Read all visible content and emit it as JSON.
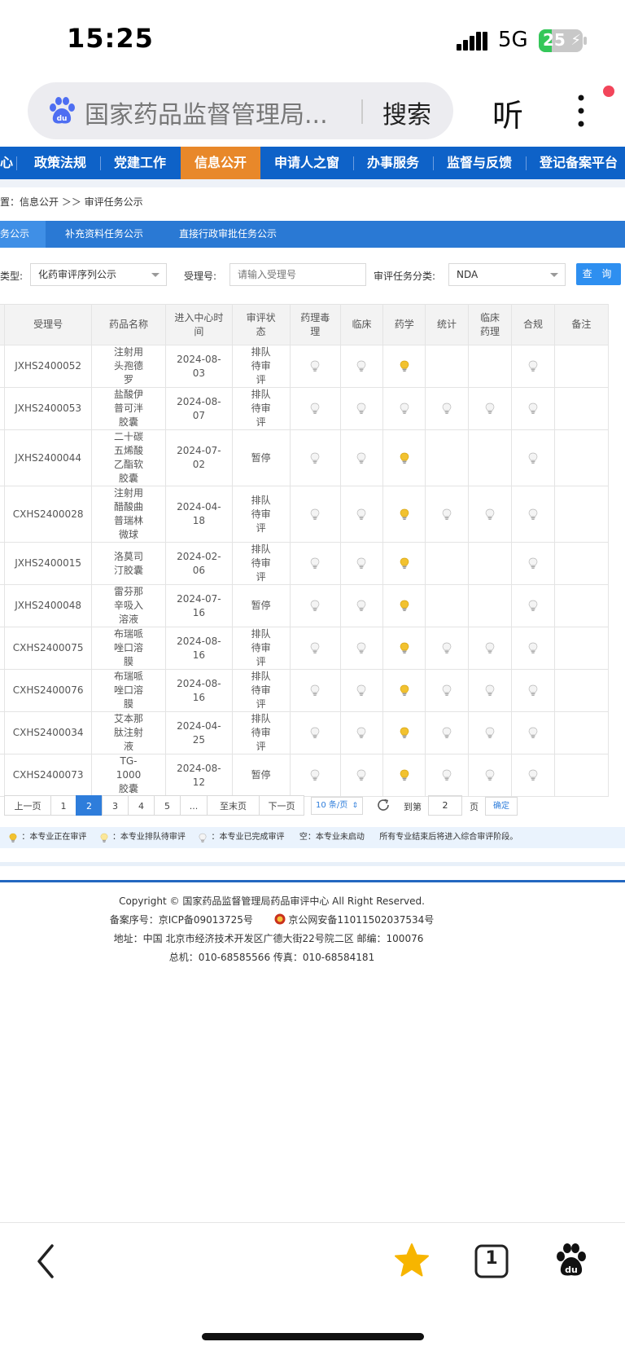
{
  "status": {
    "time": "15:25",
    "network": "5G",
    "battery": "25"
  },
  "browser": {
    "query": "国家药品监督管理局...",
    "search": "搜索",
    "listen": "听"
  },
  "nav": [
    "心",
    "政策法规",
    "党建工作",
    "信息公开",
    "申请人之窗",
    "办事服务",
    "监督与反馈",
    "登记备案平台"
  ],
  "breadcrumb": "置：信息公开 ＞＞ 审评任务公示",
  "tabs": [
    "务公示",
    "补充资料任务公示",
    "直接行政审批任务公示"
  ],
  "filters": {
    "type_label": "类型:",
    "type_value": "化药审评序列公示",
    "accept_label": "受理号:",
    "accept_placeholder": "请输入受理号",
    "category_label": "审评任务分类:",
    "category_value": "NDA",
    "query": "查 询"
  },
  "table": {
    "headers": [
      "受理号",
      "药品名称",
      "进入中心时间",
      "审评状态",
      "药理毒理",
      "临床",
      "药学",
      "统计",
      "临床药理",
      "合规",
      "备注"
    ],
    "rows": [
      {
        "id": "JXHS2400052",
        "name": "注射用头孢德罗",
        "date": "2024-08-03",
        "status": "排队待审评",
        "lights": [
          "w",
          "w",
          "y",
          "",
          "",
          "w",
          ""
        ]
      },
      {
        "id": "JXHS2400053",
        "name": "盐酸伊普可泮胶囊",
        "date": "2024-08-07",
        "status": "排队待审评",
        "lights": [
          "w",
          "w",
          "w",
          "w",
          "w",
          "w",
          ""
        ]
      },
      {
        "id": "JXHS2400044",
        "name": "二十碳五烯酸乙酯软胶囊",
        "date": "2024-07-02",
        "status": "暂停",
        "lights": [
          "w",
          "w",
          "y",
          "",
          "",
          "w",
          ""
        ]
      },
      {
        "id": "CXHS2400028",
        "name": "注射用醋酸曲普瑞林微球",
        "date": "2024-04-18",
        "status": "排队待审评",
        "lights": [
          "w",
          "w",
          "y",
          "w",
          "w",
          "w",
          ""
        ]
      },
      {
        "id": "JXHS2400015",
        "name": "洛莫司汀胶囊",
        "date": "2024-02-06",
        "status": "排队待审评",
        "lights": [
          "w",
          "w",
          "y",
          "",
          "",
          "w",
          ""
        ]
      },
      {
        "id": "JXHS2400048",
        "name": "雷芬那辛吸入溶液",
        "date": "2024-07-16",
        "status": "暂停",
        "lights": [
          "w",
          "w",
          "y",
          "",
          "",
          "w",
          ""
        ]
      },
      {
        "id": "CXHS2400075",
        "name": "布瑞哌唑口溶膜",
        "date": "2024-08-16",
        "status": "排队待审评",
        "lights": [
          "w",
          "w",
          "y",
          "w",
          "w",
          "w",
          ""
        ]
      },
      {
        "id": "CXHS2400076",
        "name": "布瑞哌唑口溶膜",
        "date": "2024-08-16",
        "status": "排队待审评",
        "lights": [
          "w",
          "w",
          "y",
          "w",
          "w",
          "w",
          ""
        ]
      },
      {
        "id": "CXHS2400034",
        "name": "艾本那肽注射液",
        "date": "2024-04-25",
        "status": "排队待审评",
        "lights": [
          "w",
          "w",
          "y",
          "w",
          "w",
          "w",
          ""
        ]
      },
      {
        "id": "CXHS2400073",
        "name": "TG-1000胶囊",
        "date": "2024-08-12",
        "status": "暂停",
        "lights": [
          "w",
          "w",
          "y",
          "w",
          "w",
          "w",
          ""
        ]
      }
    ]
  },
  "pager": {
    "prev": "上一页",
    "pages": [
      "1",
      "2",
      "3",
      "4",
      "5",
      "..."
    ],
    "current": "2",
    "last": "至末页",
    "next": "下一页",
    "page_size": "10 条/页",
    "goto_label": "到第",
    "goto_value": "2",
    "page_unit": "页",
    "confirm": "确定"
  },
  "legend": {
    "active": "：本专业正在审评",
    "queued": "：本专业排队待审评",
    "done": "：本专业已完成审评",
    "empty": "空：本专业未启动",
    "note": "所有专业结束后将进入综合审评阶段。"
  },
  "footer": {
    "copyright": "Copyright © 国家药品监督管理局药品审评中心    All Right Reserved.",
    "icp": "备案序号：京ICP备09013725号",
    "police": "京公网安备11011502037534号",
    "address": "地址：中国 北京市经济技术开发区广德大街22号院二区     邮编：100076",
    "phone": "总机：010-68585566      传真：010-68584181"
  },
  "bottom": {
    "tab_count": "1"
  },
  "colors": {
    "nav_blue": "#0e62c8",
    "nav_active": "#e8882a",
    "tab_blue": "#2a79d4",
    "query_btn": "#2e8ff0",
    "bulb_yellow": "#f2c230"
  }
}
